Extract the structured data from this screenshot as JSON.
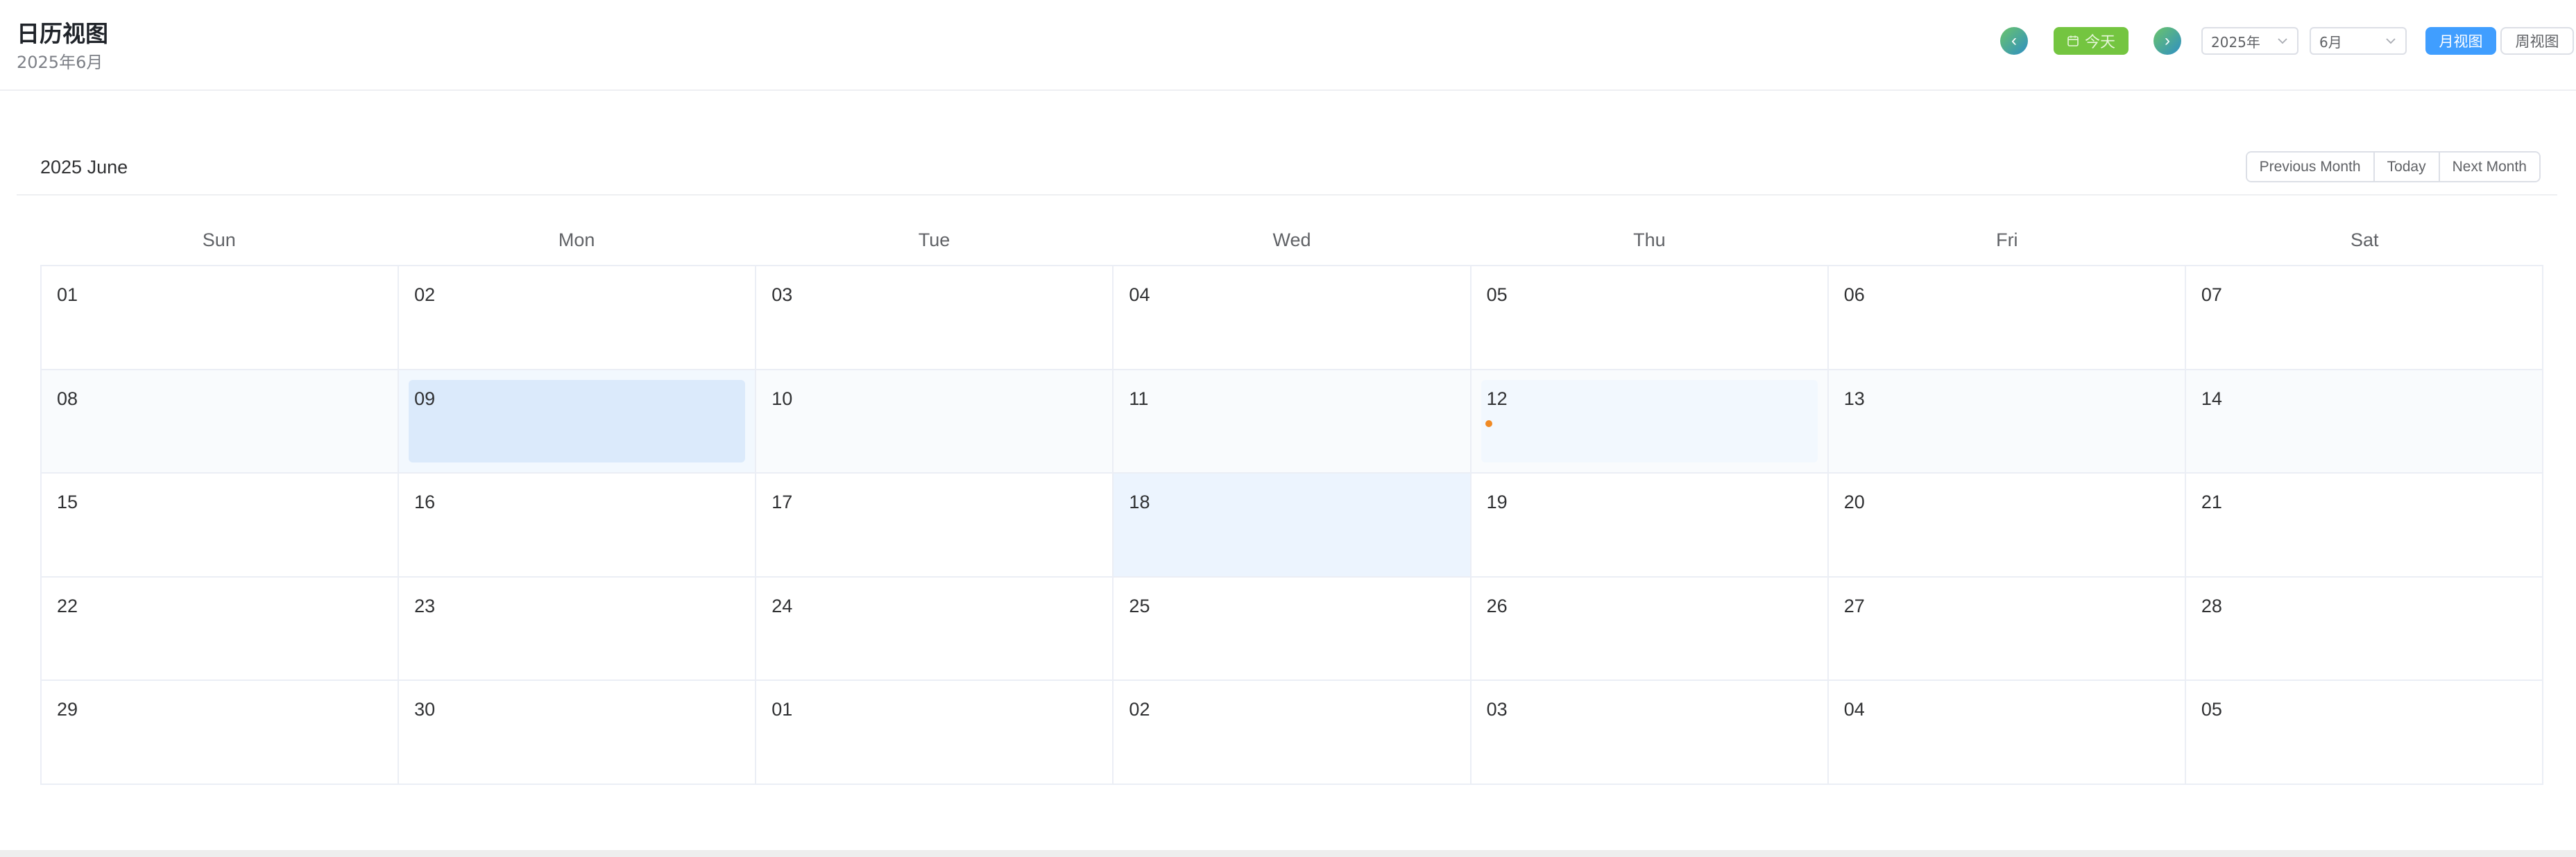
{
  "header": {
    "title": "日历视图",
    "subtitle": "2025年6月",
    "prev_icon": "chevron-left-icon",
    "next_icon": "chevron-right-icon",
    "today_label": "今天",
    "year_select": "2025年",
    "month_select": "6月",
    "month_view_label": "月视图",
    "week_view_label": "周视图",
    "accent": "#409eff",
    "today_button_color": "#74c540"
  },
  "calendar": {
    "title": "2025 June",
    "prev_month": "Previous Month",
    "today": "Today",
    "next_month": "Next Month",
    "weekdays": [
      "Sun",
      "Mon",
      "Tue",
      "Wed",
      "Thu",
      "Fri",
      "Sat"
    ],
    "days": [
      "01",
      "02",
      "03",
      "04",
      "05",
      "06",
      "07",
      "08",
      "09",
      "10",
      "11",
      "12",
      "13",
      "14",
      "15",
      "16",
      "17",
      "18",
      "19",
      "20",
      "21",
      "22",
      "23",
      "24",
      "25",
      "26",
      "27",
      "28",
      "29",
      "30",
      "01",
      "02",
      "03",
      "04",
      "05"
    ],
    "event_dot_color": "#f08a24"
  }
}
